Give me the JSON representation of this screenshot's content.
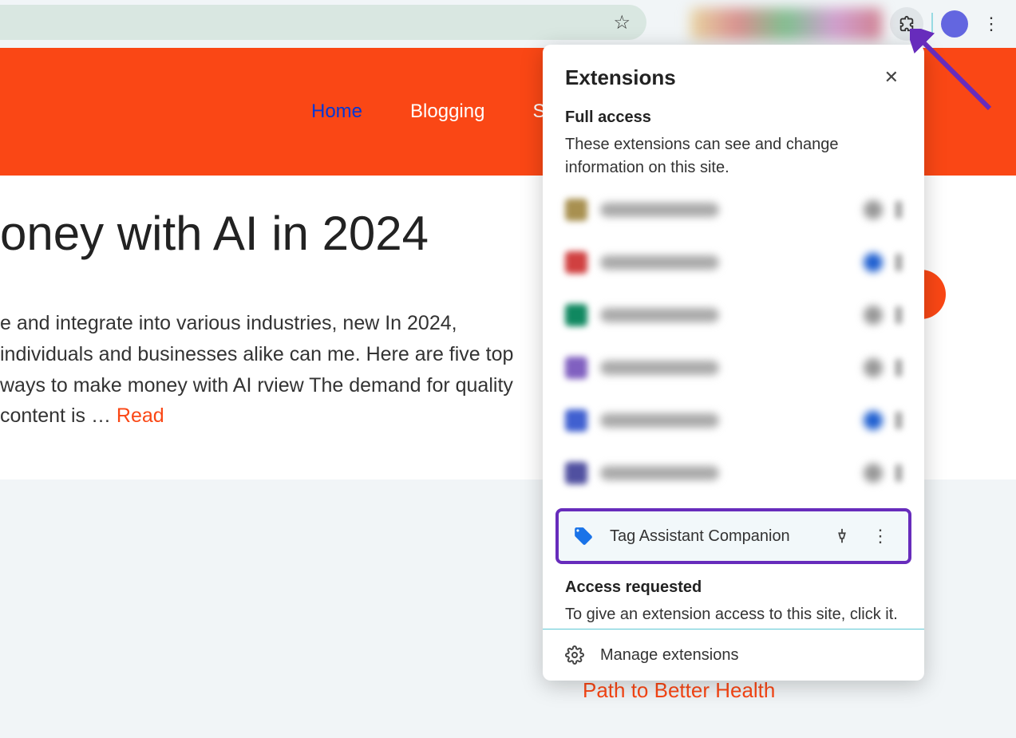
{
  "nav": {
    "items": [
      {
        "label": "Home",
        "active": true
      },
      {
        "label": "Blogging",
        "active": false
      },
      {
        "label": "S"
      }
    ]
  },
  "article": {
    "title_fragment": "oney with AI in 2024",
    "body_fragment": "e and integrate into various industries, new In 2024, individuals and businesses alike can me. Here are five top ways to make money with AI rview The demand for quality content is …",
    "read_more": "Read"
  },
  "recent": {
    "title_fragment": "The Mediterranean Diet: A Delicious Path to Better Health"
  },
  "extensions_popup": {
    "title": "Extensions",
    "full_access": {
      "heading": "Full access",
      "description": "These extensions can see and change information on this site."
    },
    "highlighted_item": {
      "name": "Tag Assistant Companion"
    },
    "access_requested": {
      "heading": "Access requested",
      "description": "To give an extension access to this site, click it."
    },
    "manage_label": "Manage extensions"
  }
}
